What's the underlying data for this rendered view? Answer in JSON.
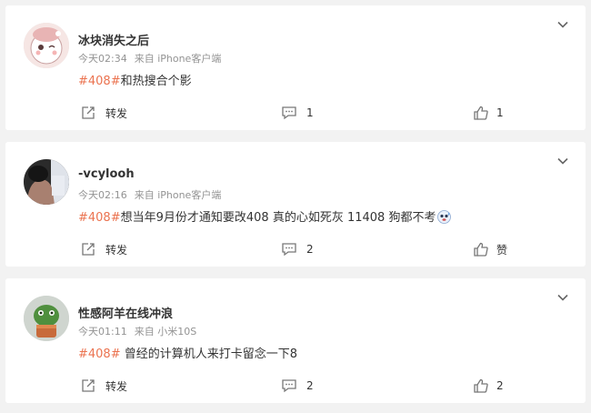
{
  "posts": [
    {
      "username": "冰块消失之后",
      "time": "今天02:34",
      "source": "来自 iPhone客户端",
      "hashtag": "#408#",
      "text": "和热搜合个影",
      "share_label": "转发",
      "comment_count": "1",
      "like_label": "1"
    },
    {
      "username": "-vcylooh",
      "time": "今天02:16",
      "source": "来自 iPhone客户端",
      "hashtag": "#408#",
      "text": "想当年9月份才通知要改408 真的心如死灰 11408 狗都不考",
      "share_label": "转发",
      "comment_count": "2",
      "like_label": "赞"
    },
    {
      "username": "性感阿羊在线冲浪",
      "time": "今天01:11",
      "source": "来自 小米10S",
      "hashtag": "#408#",
      "text": " 曾经的计算机人来打卡留念一下8",
      "share_label": "转发",
      "comment_count": "2",
      "like_label": "2"
    }
  ],
  "colors": {
    "hashtag": "#eb7350",
    "name": "#333333",
    "meta": "#939393",
    "background": "#f2f2f2"
  },
  "icons": {
    "menu": "chevron-down-icon",
    "share": "share-icon",
    "comment": "comment-icon",
    "like": "thumb-up-icon"
  }
}
